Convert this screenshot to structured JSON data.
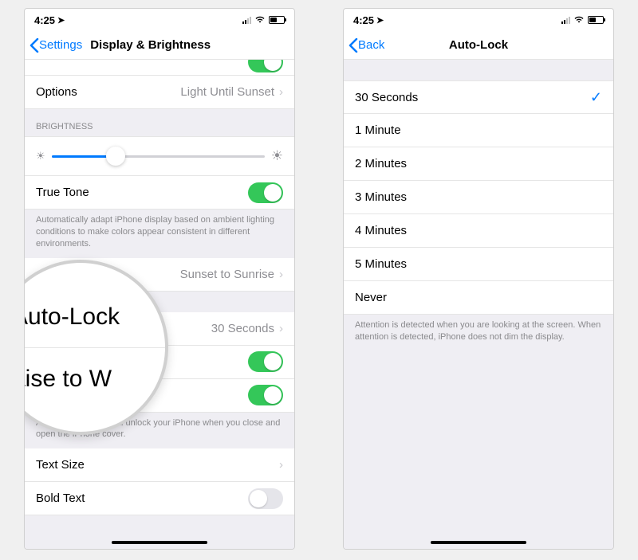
{
  "statusbar": {
    "time": "4:25",
    "loc_glyph": "➤"
  },
  "screen1": {
    "back_label": "Settings",
    "title": "Display & Brightness",
    "options_label": "Options",
    "options_value": "Light Until Sunset",
    "brightness_header": "BRIGHTNESS",
    "truetone_label": "True Tone",
    "truetone_footer": "Automatically adapt iPhone display based on ambient lighting conditions to make colors appear consistent in different environments.",
    "nightshift_value": "Sunset to Sunrise",
    "autolock_label": "Auto-Lock",
    "autolock_value": "30 Seconds",
    "lock_footer": "Automatically lock and unlock your iPhone when you close and open the iPhone cover.",
    "textsize_label": "Text Size",
    "boldtext_label": "Bold Text",
    "magnifier": {
      "line1": "Auto-Lock",
      "line2": "aise to W"
    }
  },
  "screen2": {
    "back_label": "Back",
    "title": "Auto-Lock",
    "options": [
      "30 Seconds",
      "1 Minute",
      "2 Minutes",
      "3 Minutes",
      "4 Minutes",
      "5 Minutes",
      "Never"
    ],
    "selected_index": 0,
    "footer": "Attention is detected when you are looking at the screen. When attention is detected, iPhone does not dim the display."
  }
}
